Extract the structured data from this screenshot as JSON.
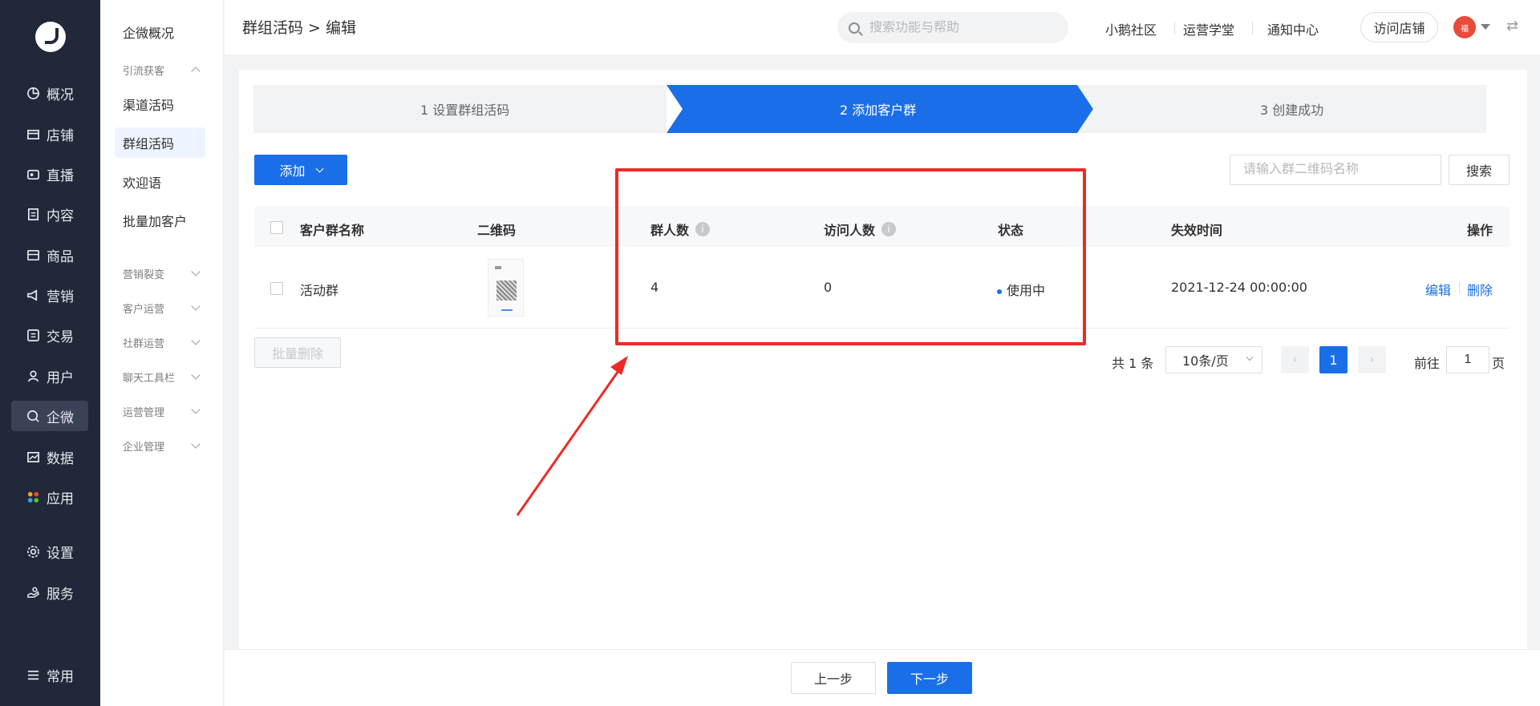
{
  "sidebar": {
    "items": [
      {
        "label": "概况",
        "icon": "pie-chart-icon"
      },
      {
        "label": "店铺",
        "icon": "store-icon"
      },
      {
        "label": "直播",
        "icon": "live-icon"
      },
      {
        "label": "内容",
        "icon": "document-icon"
      },
      {
        "label": "商品",
        "icon": "bag-icon"
      },
      {
        "label": "营销",
        "icon": "megaphone-icon"
      },
      {
        "label": "交易",
        "icon": "trade-icon"
      },
      {
        "label": "用户",
        "icon": "user-icon"
      },
      {
        "label": "企微",
        "icon": "chat-icon",
        "active": true
      },
      {
        "label": "数据",
        "icon": "data-icon"
      },
      {
        "label": "应用",
        "icon": "apps-icon"
      },
      {
        "label": "设置",
        "icon": "gear-icon"
      },
      {
        "label": "服务",
        "icon": "service-icon"
      },
      {
        "label": "常用",
        "icon": "list-icon"
      }
    ]
  },
  "subnav": {
    "overview": "企微概况",
    "group_traffic": "引流获客",
    "channel_code": "渠道活码",
    "group_code": "群组活码",
    "welcome": "欢迎语",
    "batch_add": "批量加客户",
    "groups": [
      "营销裂变",
      "客户运营",
      "社群运营",
      "聊天工具栏",
      "运营管理",
      "企业管理"
    ]
  },
  "header": {
    "breadcrumb": "群组活码 > 编辑",
    "search_placeholder": "搜索功能与帮助",
    "links": [
      "小鹅社区",
      "运营学堂",
      "通知中心"
    ],
    "visit_store": "访问店铺",
    "avatar_text": "福",
    "swap": "⇄"
  },
  "steps": [
    {
      "label": "1 设置群组活码",
      "active": false
    },
    {
      "label": "2 添加客户群",
      "active": true
    },
    {
      "label": "3 创建成功",
      "active": false
    }
  ],
  "toolbar": {
    "add_label": "添加",
    "filter_placeholder": "请输入群二维码名称",
    "search_label": "搜索"
  },
  "table": {
    "columns": [
      "客户群名称",
      "二维码",
      "群人数",
      "访问人数",
      "状态",
      "失效时间",
      "操作"
    ],
    "info_glyph": "i",
    "rows": [
      {
        "name": "活动群",
        "members": "4",
        "visitors": "0",
        "status": "使用中",
        "expire": "2021-12-24 00:00:00",
        "edit": "编辑",
        "delete": "删除"
      }
    ]
  },
  "pagination": {
    "batch_delete": "批量删除",
    "total": "共 1 条",
    "page_size": "10条/页",
    "prev": "‹",
    "current": "1",
    "next": "›",
    "goto_label": "前往",
    "goto_value": "1",
    "page_suffix": "页"
  },
  "footer": {
    "prev_label": "上一步",
    "next_label": "下一步"
  },
  "colors": {
    "primary": "#1a6fe8",
    "sidebar_bg": "#212839",
    "annotation": "#ef2a26"
  }
}
